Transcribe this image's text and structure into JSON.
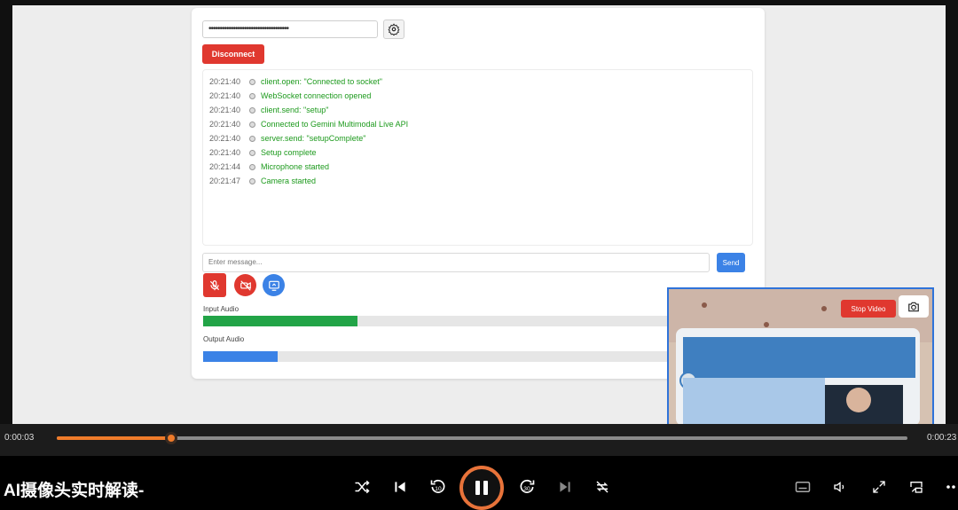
{
  "app": {
    "api_key_masked": "••••••••••••••••••••••••••••••••••••",
    "disconnect_label": "Disconnect",
    "logs": [
      {
        "time": "20:21:40",
        "message": "client.open: \"Connected to socket\""
      },
      {
        "time": "20:21:40",
        "message": "WebSocket connection opened"
      },
      {
        "time": "20:21:40",
        "message": "client.send: \"setup\""
      },
      {
        "time": "20:21:40",
        "message": "Connected to Gemini Multimodal Live API"
      },
      {
        "time": "20:21:40",
        "message": "server.send: \"setupComplete\""
      },
      {
        "time": "20:21:40",
        "message": "Setup complete"
      },
      {
        "time": "20:21:44",
        "message": "Microphone started"
      },
      {
        "time": "20:21:47",
        "message": "Camera started"
      }
    ],
    "message_placeholder": "Enter message...",
    "send_label": "Send",
    "input_audio_label": "Input Audio",
    "input_audio_level": 0.31,
    "output_audio_label": "Output Audio",
    "output_audio_level": 0.15,
    "stop_video_label": "Stop Video"
  },
  "player": {
    "current_time": "0:00:03",
    "total_time": "0:00:23",
    "progress": 0.134,
    "title": "AI摄像头实时解读-"
  },
  "colors": {
    "accent_orange": "#ef7b2a",
    "danger_red": "#e0382f",
    "primary_blue": "#3b82e6",
    "log_green": "#1d9a1d",
    "meter_green": "#22a447"
  }
}
